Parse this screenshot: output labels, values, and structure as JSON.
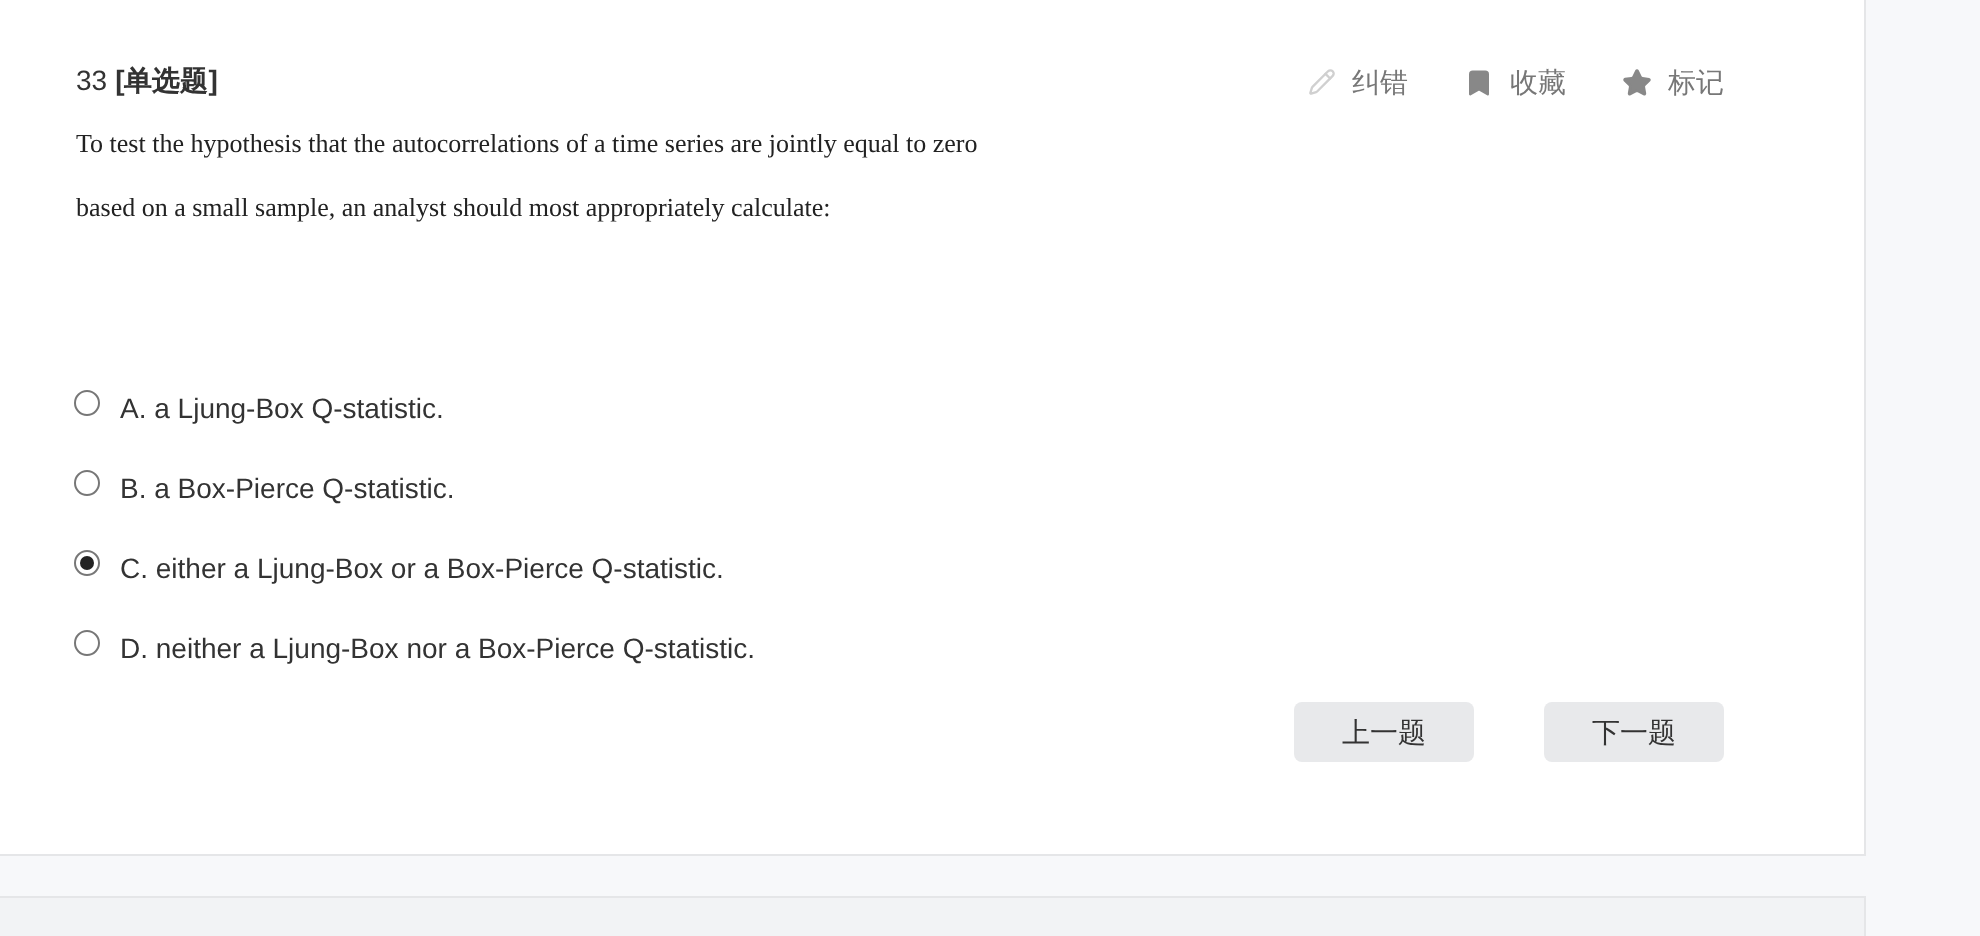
{
  "question": {
    "number": "33",
    "type": "[单选题]",
    "text": "To test the hypothesis that the autocorrelations of a time series are jointly equal to zero based on a small sample, an analyst should most appropriately calculate:"
  },
  "actions": [
    {
      "kind": "edit",
      "label": "纠错"
    },
    {
      "kind": "bookmark",
      "label": "收藏"
    },
    {
      "kind": "star",
      "label": "标记"
    }
  ],
  "options": [
    {
      "label": "A. a Ljung-Box Q-statistic.",
      "selected": false
    },
    {
      "label": "B. a Box-Pierce Q-statistic.",
      "selected": false
    },
    {
      "label": "C. either a Ljung-Box or a Box-Pierce Q-statistic.",
      "selected": true
    },
    {
      "label": "D. neither a Ljung-Box nor a Box-Pierce Q-statistic.",
      "selected": false
    }
  ],
  "buttons": [
    "上一题",
    "下一题"
  ]
}
